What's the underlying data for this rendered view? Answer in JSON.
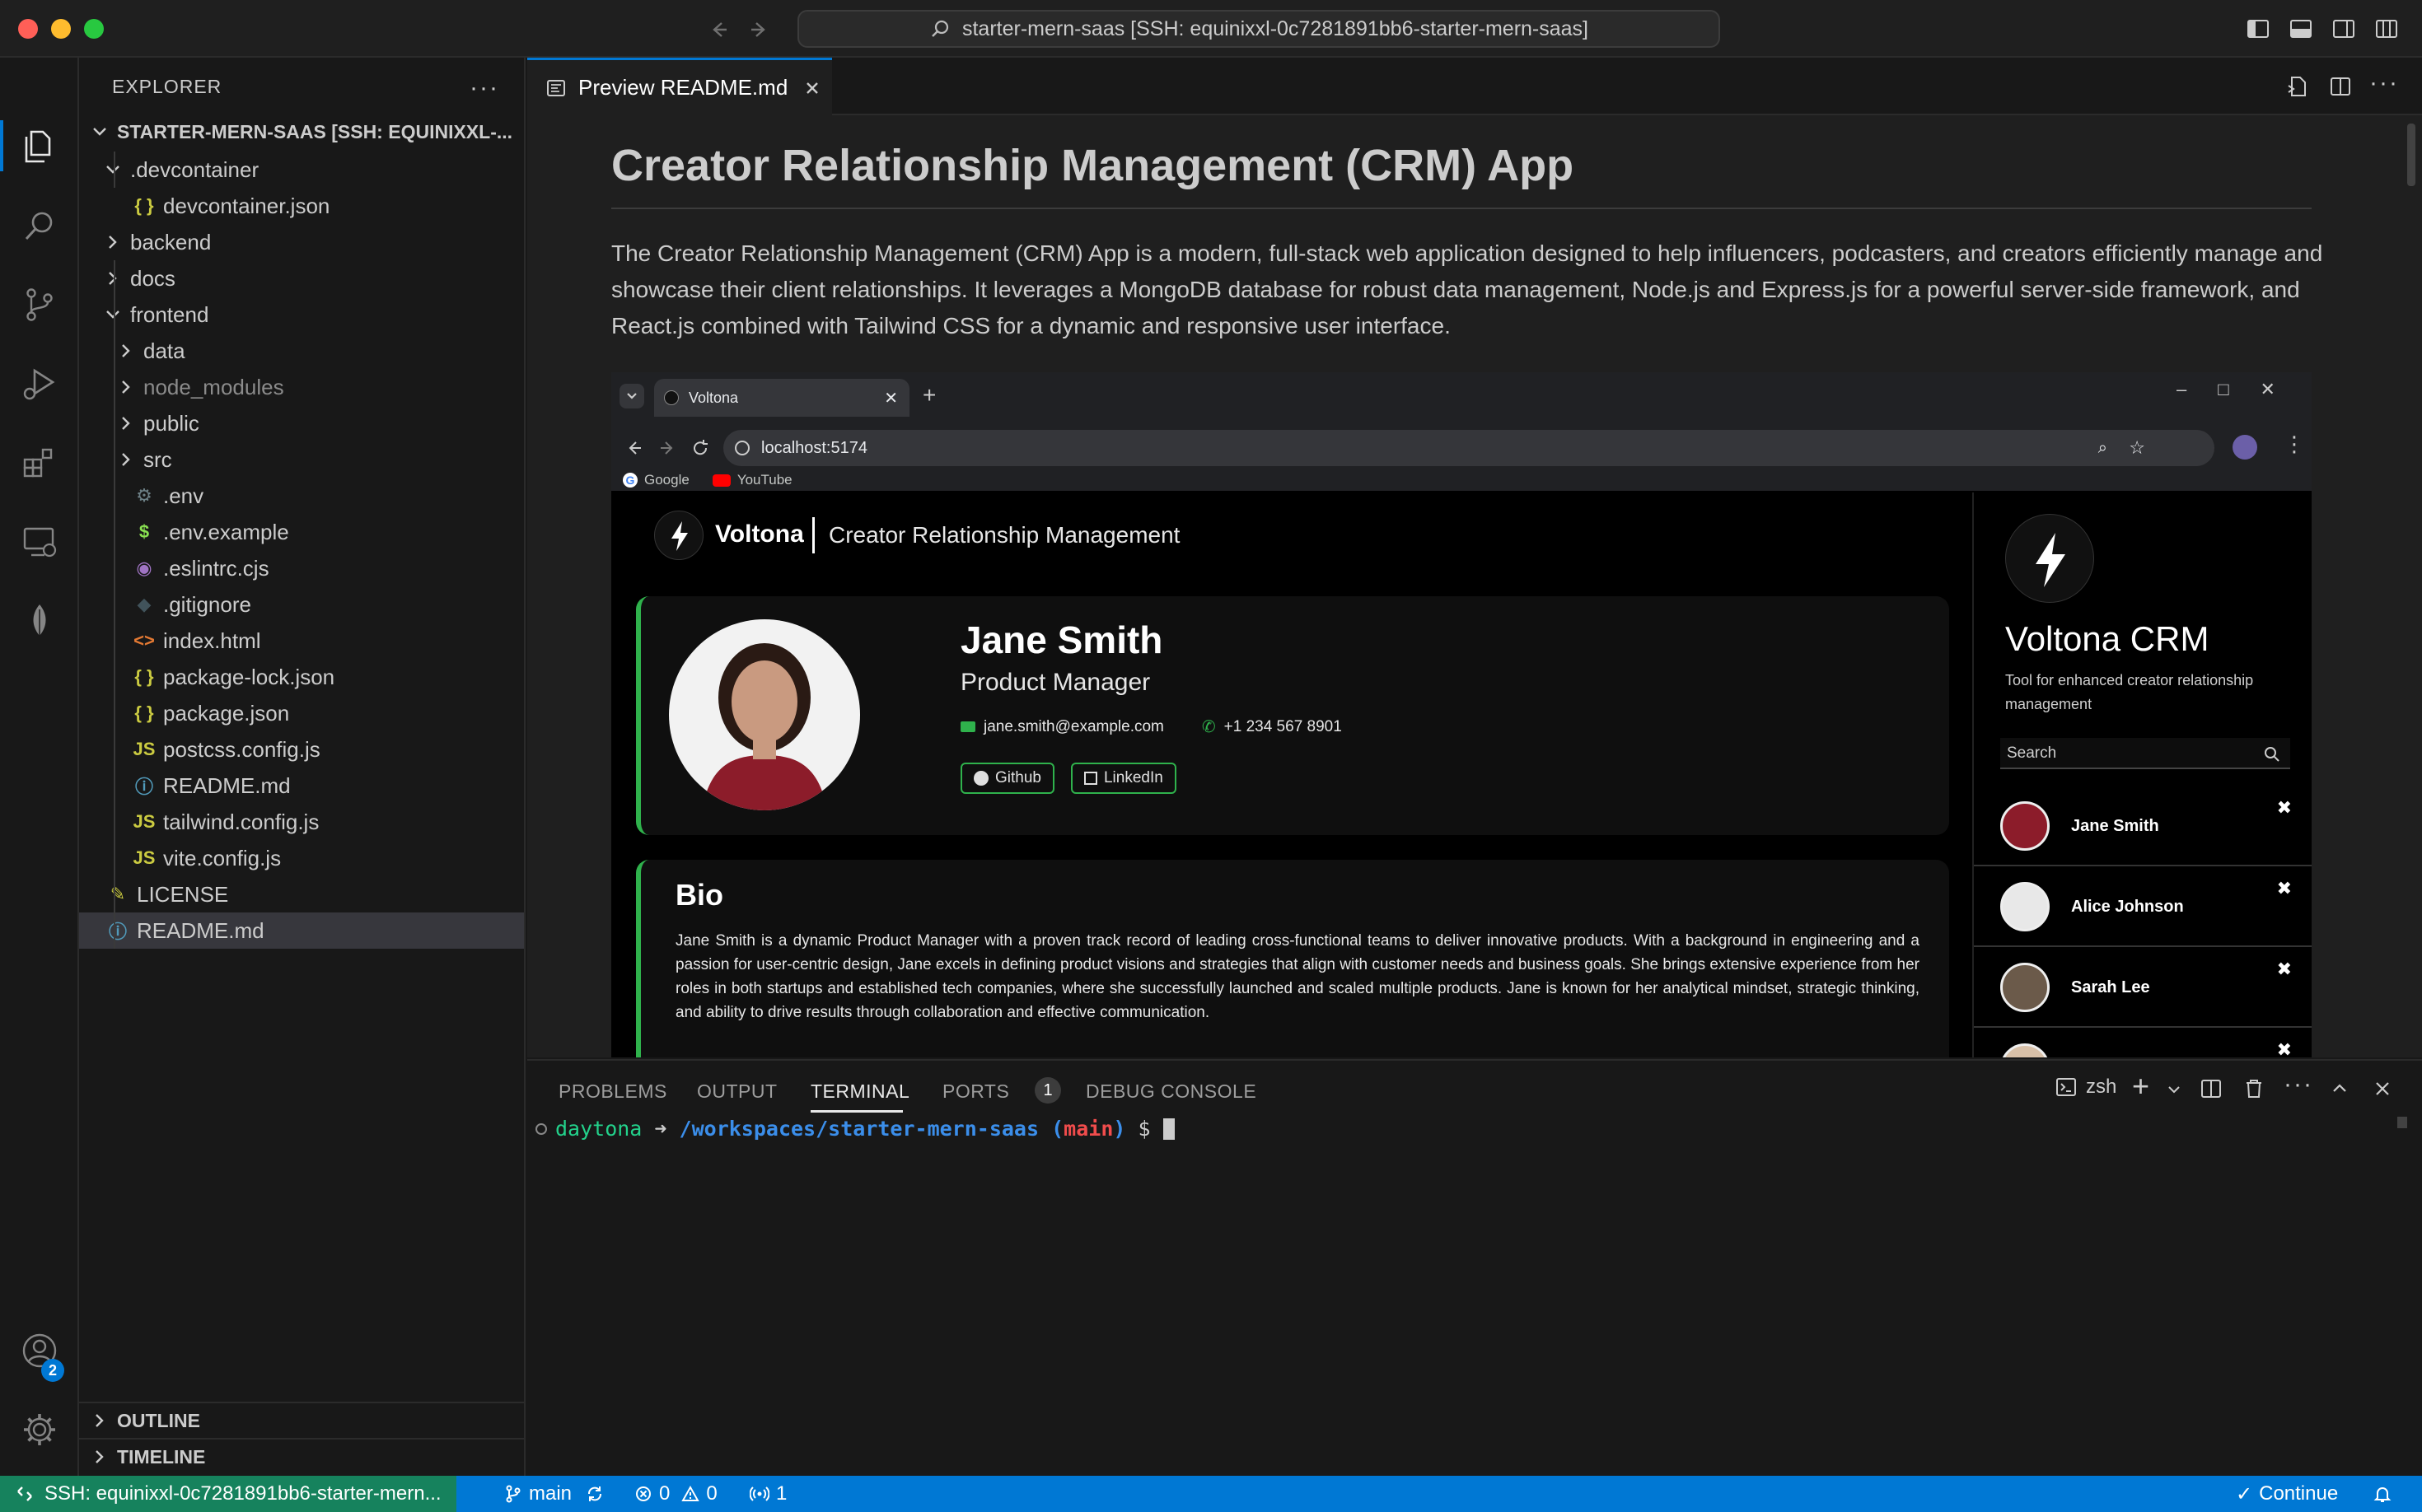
{
  "window": {
    "title": "starter-mern-saas [SSH: equinixxl-0c7281891bb6-starter-mern-saas]"
  },
  "activity_bar": {
    "accounts_badge": "2"
  },
  "explorer": {
    "title": "EXPLORER",
    "root": "STARTER-MERN-SAAS [SSH: EQUINIXXL-...",
    "items": [
      {
        "label": ".devcontainer",
        "icon": "chevron-down-icon",
        "glyph": ""
      },
      {
        "label": "devcontainer.json",
        "icon": "json-icon",
        "glyph": "{ }"
      },
      {
        "label": "backend",
        "icon": "chevron-right-icon",
        "glyph": ""
      },
      {
        "label": "docs",
        "icon": "chevron-right-icon",
        "glyph": ""
      },
      {
        "label": "frontend",
        "icon": "chevron-down-icon",
        "glyph": ""
      },
      {
        "label": "data",
        "icon": "chevron-right-icon",
        "glyph": ""
      },
      {
        "label": "node_modules",
        "icon": "chevron-right-icon",
        "glyph": ""
      },
      {
        "label": "public",
        "icon": "chevron-right-icon",
        "glyph": ""
      },
      {
        "label": "src",
        "icon": "chevron-right-icon",
        "glyph": ""
      },
      {
        "label": ".env",
        "icon": "gear-icon",
        "glyph": "⚙"
      },
      {
        "label": ".env.example",
        "icon": "dollar-icon",
        "glyph": "$"
      },
      {
        "label": ".eslintrc.cjs",
        "icon": "eslint-icon",
        "glyph": "◉"
      },
      {
        "label": ".gitignore",
        "icon": "git-icon",
        "glyph": "◆"
      },
      {
        "label": "index.html",
        "icon": "html-icon",
        "glyph": "<>"
      },
      {
        "label": "package-lock.json",
        "icon": "json-icon",
        "glyph": "{ }"
      },
      {
        "label": "package.json",
        "icon": "json-icon",
        "glyph": "{ }"
      },
      {
        "label": "postcss.config.js",
        "icon": "js-icon",
        "glyph": "JS"
      },
      {
        "label": "README.md",
        "icon": "info-icon",
        "glyph": "ⓘ"
      },
      {
        "label": "tailwind.config.js",
        "icon": "js-icon",
        "glyph": "JS"
      },
      {
        "label": "vite.config.js",
        "icon": "js-icon",
        "glyph": "JS"
      },
      {
        "label": "LICENSE",
        "icon": "license-icon",
        "glyph": "✎"
      },
      {
        "label": "README.md",
        "icon": "info-icon",
        "glyph": "ⓘ"
      }
    ],
    "outline": "OUTLINE",
    "timeline": "TIMELINE"
  },
  "editor": {
    "tab_label": "Preview README.md",
    "md_title": "Creator Relationship Management (CRM) App",
    "md_paragraph": "The Creator Relationship Management (CRM) App is a modern, full-stack web application designed to help influencers, podcasters, and creators efficiently manage and showcase their client relationships. It leverages a MongoDB database for robust data management, Node.js and Express.js for a powerful server-side framework, and React.js combined with Tailwind CSS for a dynamic and responsive user interface."
  },
  "screenshot": {
    "browser_tab": "Voltona",
    "url": "localhost:5174",
    "bookmarks": [
      "Google",
      "YouTube"
    ],
    "brand": "Voltona",
    "brand_tagline": "Creator Relationship Management",
    "profile": {
      "name": "Jane Smith",
      "role": "Product Manager",
      "email": "jane.smith@example.com",
      "phone": "+1 234 567 8901",
      "github": "Github",
      "linkedin": "LinkedIn"
    },
    "bio_title": "Bio",
    "bio_text": "Jane Smith is a dynamic Product Manager with a proven track record of leading cross-functional teams to deliver innovative products. With a background in engineering and a passion for user-centric design, Jane excels in defining product visions and strategies that align with customer needs and business goals. She brings extensive experience from her roles in both startups and established tech companies, where she successfully launched and scaled multiple products. Jane is known for her analytical mindset, strategic thinking, and ability to drive results through collaboration and effective communication.",
    "side": {
      "title": "Voltona CRM",
      "subtitle": "Tool for enhanced creator relationship management",
      "search_placeholder": "Search",
      "people": [
        "Jane Smith",
        "Alice Johnson",
        "Sarah Lee"
      ]
    }
  },
  "panel": {
    "tabs": {
      "problems": "PROBLEMS",
      "output": "OUTPUT",
      "terminal": "TERMINAL",
      "ports": "PORTS",
      "debug": "DEBUG CONSOLE"
    },
    "ports_badge": "1",
    "shell": "zsh",
    "prompt": {
      "user": "daytona",
      "arrow": "➜",
      "path": "/workspaces/starter-mern-saas",
      "branch_open": "(",
      "branch": "main",
      "branch_close": ")",
      "dollar": "$"
    }
  },
  "statusbar": {
    "remote": "SSH: equinixxl-0c7281891bb6-starter-mern...",
    "branch": "main",
    "errors": "0",
    "warnings": "0",
    "ports": "1",
    "continue": "Continue"
  },
  "colors": {
    "accent": "#0078d4",
    "remote": "#16825d",
    "green": "#2fb24c",
    "prompt_user": "#23d18b",
    "prompt_path": "#3b8eea",
    "prompt_branch": "#f14c4c"
  }
}
